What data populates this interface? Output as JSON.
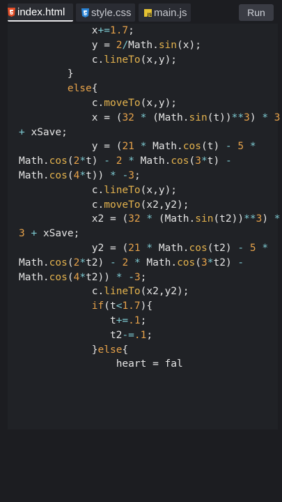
{
  "tabs": [
    {
      "label": "index.html",
      "icon": "html5-icon",
      "active": true
    },
    {
      "label": "style.css",
      "icon": "css3-icon",
      "active": false
    },
    {
      "label": "main.js",
      "icon": "js-icon",
      "active": false
    }
  ],
  "run_label": "Run",
  "colors": {
    "keyword": "#e6a24a",
    "function": "#e3b24d",
    "operator": "#7ecbd3",
    "text": "#e6e6e6",
    "editor_bg": "#202226",
    "page_bg": "#1c1d21"
  },
  "code_lines": [
    "            x+=1.7;",
    "            y = 2/Math.sin(x);",
    "            c.lineTo(x,y);",
    "        }",
    "        else{",
    "            c.moveTo(x,y);",
    "            x = (32 * (Math.sin(t))**3) * 3",
    "+ xSave;",
    "            y = (21 * Math.cos(t) - 5 *",
    "Math.cos(2*t) - 2 * Math.cos(3*t) -",
    "Math.cos(4*t)) * -3;",
    "            c.lineTo(x,y);",
    "            c.moveTo(x2,y2);",
    "            x2 = (32 * (Math.sin(t2))**3) *",
    "3 + xSave;",
    "            y2 = (21 * Math.cos(t2) - 5 *",
    "Math.cos(2*t2) - 2 * Math.cos(3*t2) -",
    "Math.cos(4*t2)) * -3;",
    "            c.lineTo(x2,y2);",
    "            if(t<1.7){",
    "               t+=.1;",
    "               t2-=.1;",
    "            }else{",
    "                heart = fal"
  ]
}
